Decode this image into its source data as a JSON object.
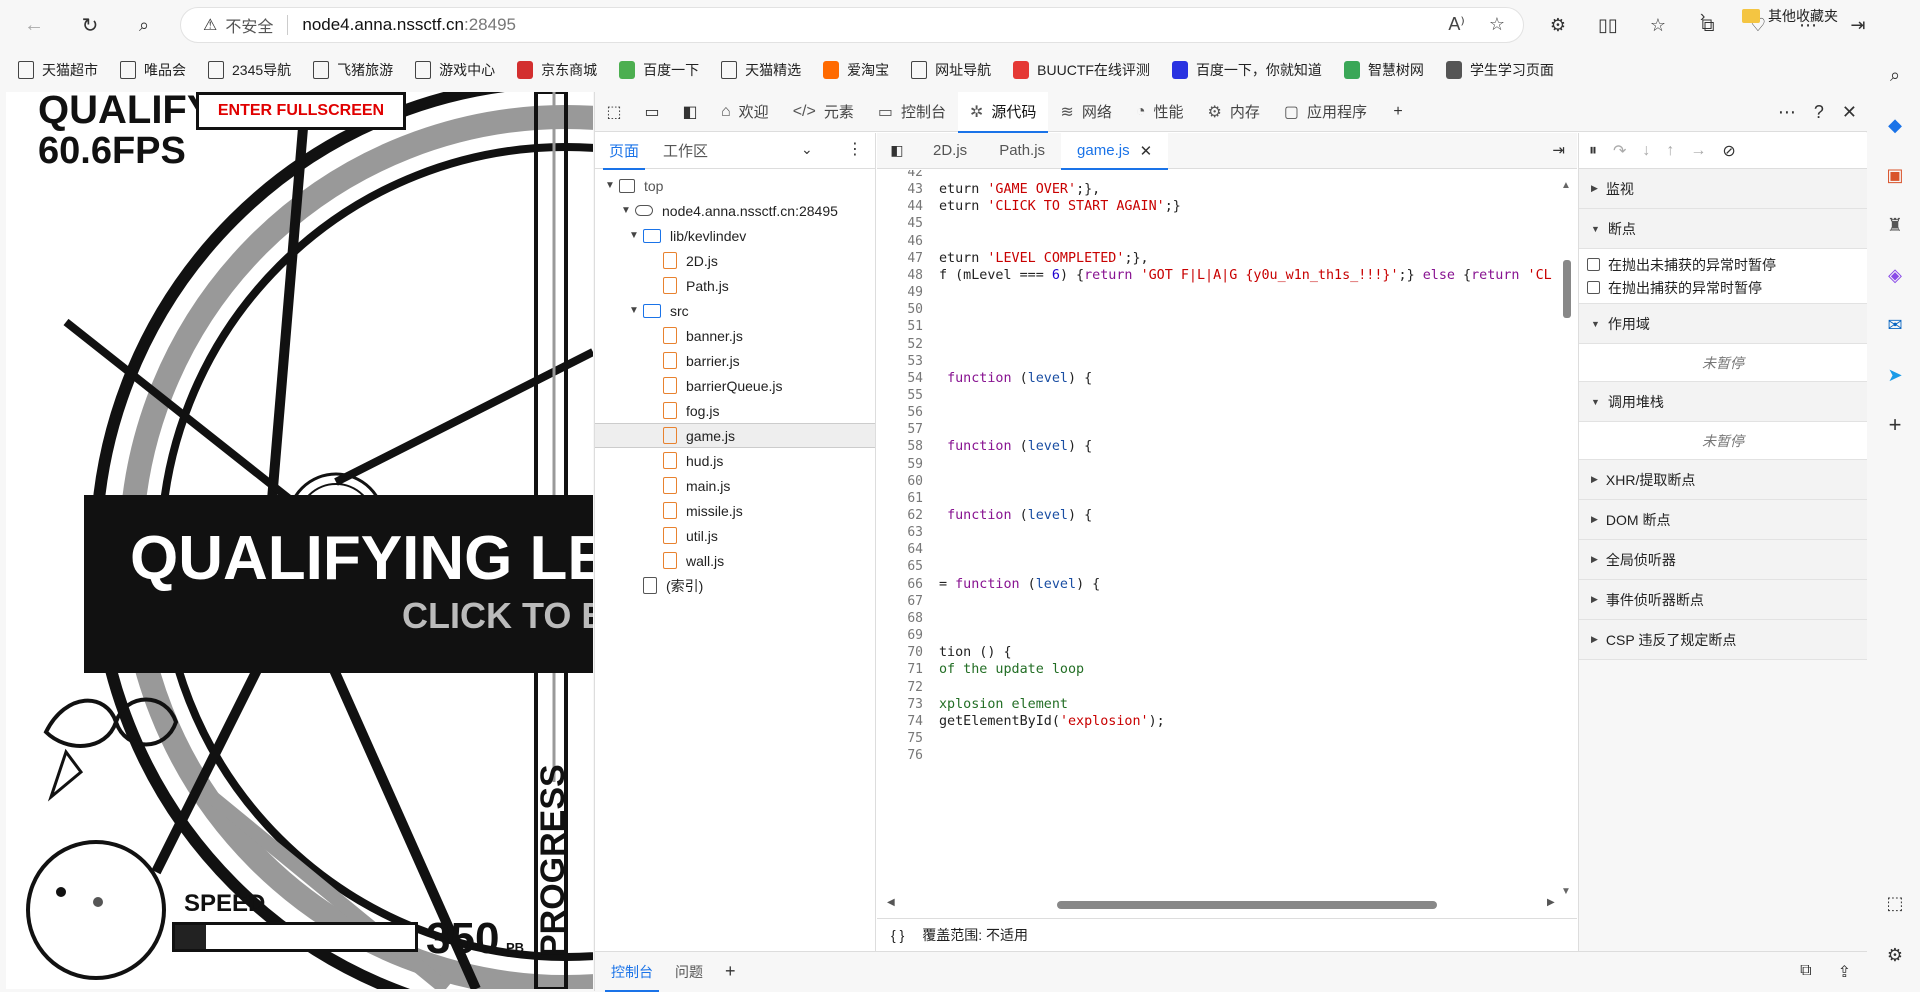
{
  "browser": {
    "security_label": "不安全",
    "url_host": "node4.anna.nssctf.cn",
    "url_port": ":28495"
  },
  "bookmarks": [
    {
      "label": "天猫超市",
      "color": ""
    },
    {
      "label": "唯品会",
      "color": ""
    },
    {
      "label": "2345导航",
      "color": ""
    },
    {
      "label": "飞猪旅游",
      "color": ""
    },
    {
      "label": "游戏中心",
      "color": ""
    },
    {
      "label": "京东商城",
      "color": "#d32f2f"
    },
    {
      "label": "百度一下",
      "color": "#4caf50"
    },
    {
      "label": "天猫精选",
      "color": ""
    },
    {
      "label": "爱淘宝",
      "color": "#ff6a00"
    },
    {
      "label": "网址导航",
      "color": ""
    },
    {
      "label": "BUUCTF在线评测",
      "color": "#e53935"
    },
    {
      "label": "百度一下，你就知道",
      "color": "#2932e1"
    },
    {
      "label": "智慧树网",
      "color": "#3aa757"
    },
    {
      "label": "学生学习页面",
      "color": "#555555"
    }
  ],
  "bookmarks_folder": "其他收藏夹",
  "game": {
    "qualify_top": "QUALIFY",
    "fps": "60.6FPS",
    "fullscreen_label": "ENTER FULLSCREEN",
    "banner_title": "QUALIFYING LEV",
    "banner_sub": "CLICK TO B",
    "speed_label": "SPEED",
    "speed_value": "350",
    "speed_unit": "PB",
    "speed_fraction": 0.13,
    "progress_label": "PROGRESS"
  },
  "devtools": {
    "tabs": [
      {
        "label": "欢迎",
        "icon": "home-icon"
      },
      {
        "label": "元素",
        "icon": "code-icon"
      },
      {
        "label": "控制台",
        "icon": "console-icon"
      },
      {
        "label": "源代码",
        "icon": "bug-icon",
        "active": true
      },
      {
        "label": "网络",
        "icon": "wifi-icon"
      },
      {
        "label": "性能",
        "icon": "gauge-icon"
      },
      {
        "label": "内存",
        "icon": "chip-icon"
      },
      {
        "label": "应用程序",
        "icon": "app-icon"
      }
    ],
    "navigator_tabs": [
      "页面",
      "工作区"
    ],
    "tree": [
      {
        "label": "top",
        "depth": 0,
        "kind": "page",
        "arrow": "▼"
      },
      {
        "label": "node4.anna.nssctf.cn:28495",
        "depth": 1,
        "kind": "cloud",
        "arrow": "▼"
      },
      {
        "label": "lib/kevlindev",
        "depth": 2,
        "kind": "dir",
        "arrow": "▼"
      },
      {
        "label": "2D.js",
        "depth": 3,
        "kind": "file",
        "arrow": ""
      },
      {
        "label": "Path.js",
        "depth": 3,
        "kind": "file",
        "arrow": ""
      },
      {
        "label": "src",
        "depth": 2,
        "kind": "dir",
        "arrow": "▼"
      },
      {
        "label": "banner.js",
        "depth": 3,
        "kind": "file",
        "arrow": ""
      },
      {
        "label": "barrier.js",
        "depth": 3,
        "kind": "file",
        "arrow": ""
      },
      {
        "label": "barrierQueue.js",
        "depth": 3,
        "kind": "file",
        "arrow": ""
      },
      {
        "label": "fog.js",
        "depth": 3,
        "kind": "file",
        "arrow": ""
      },
      {
        "label": "game.js",
        "depth": 3,
        "kind": "file",
        "arrow": "",
        "selected": true
      },
      {
        "label": "hud.js",
        "depth": 3,
        "kind": "file",
        "arrow": ""
      },
      {
        "label": "main.js",
        "depth": 3,
        "kind": "file",
        "arrow": ""
      },
      {
        "label": "missile.js",
        "depth": 3,
        "kind": "file",
        "arrow": ""
      },
      {
        "label": "util.js",
        "depth": 3,
        "kind": "file",
        "arrow": ""
      },
      {
        "label": "wall.js",
        "depth": 3,
        "kind": "file",
        "arrow": ""
      },
      {
        "label": "(索引)",
        "depth": 2,
        "kind": "gray",
        "arrow": ""
      }
    ],
    "editor_tabs": [
      {
        "label": "2D.js",
        "active": false
      },
      {
        "label": "Path.js",
        "active": false
      },
      {
        "label": "game.js",
        "active": true
      }
    ],
    "code_lines": [
      {
        "n": "42",
        "html": ""
      },
      {
        "n": "43",
        "html": "eturn <span class='tk-str'>'GAME OVER'</span>;},"
      },
      {
        "n": "44",
        "html": "eturn <span class='tk-str'>'CLICK TO START AGAIN'</span>;}"
      },
      {
        "n": "45",
        "html": ""
      },
      {
        "n": "46",
        "html": ""
      },
      {
        "n": "47",
        "html": "eturn <span class='tk-str'>'LEVEL COMPLETED'</span>;},"
      },
      {
        "n": "48",
        "html": "f (mLevel === <span class='tk-num'>6</span>) {<span class='tk-kw'>return</span> <span class='tk-str'>'GOT F|L|A|G {y0u_w1n_th1s_!!!}'</span>;} <span class='tk-kw'>else</span> {<span class='tk-kw'>return</span> <span class='tk-str'>'CL</span>"
      },
      {
        "n": "49",
        "html": ""
      },
      {
        "n": "50",
        "html": ""
      },
      {
        "n": "51",
        "html": ""
      },
      {
        "n": "52",
        "html": ""
      },
      {
        "n": "53",
        "html": ""
      },
      {
        "n": "54",
        "html": " <span class='tk-fn'>function</span> (<span class='tk-var'>level</span>) {"
      },
      {
        "n": "55",
        "html": ""
      },
      {
        "n": "56",
        "html": ""
      },
      {
        "n": "57",
        "html": ""
      },
      {
        "n": "58",
        "html": " <span class='tk-fn'>function</span> (<span class='tk-var'>level</span>) {"
      },
      {
        "n": "59",
        "html": ""
      },
      {
        "n": "60",
        "html": ""
      },
      {
        "n": "61",
        "html": ""
      },
      {
        "n": "62",
        "html": " <span class='tk-fn'>function</span> (<span class='tk-var'>level</span>) {"
      },
      {
        "n": "63",
        "html": ""
      },
      {
        "n": "64",
        "html": ""
      },
      {
        "n": "65",
        "html": ""
      },
      {
        "n": "66",
        "html": "= <span class='tk-fn'>function</span> (<span class='tk-var'>level</span>) {"
      },
      {
        "n": "67",
        "html": ""
      },
      {
        "n": "68",
        "html": ""
      },
      {
        "n": "69",
        "html": ""
      },
      {
        "n": "70",
        "html": "tion () {"
      },
      {
        "n": "71",
        "html": "<span class='tk-cm'>of the update loop</span>"
      },
      {
        "n": "72",
        "html": ""
      },
      {
        "n": "73",
        "html": "<span class='tk-cm'>xplosion element</span>"
      },
      {
        "n": "74",
        "html": "getElementById(<span class='tk-str'>'explosion'</span>);"
      },
      {
        "n": "75",
        "html": ""
      },
      {
        "n": "76",
        "html": ""
      }
    ],
    "footer_braces": "{ }",
    "footer_coverage": "覆盖范围: 不适用",
    "debug_sections": {
      "watch": "监视",
      "breakpoints": "断点",
      "pause_uncaught": "在抛出未捕获的异常时暂停",
      "pause_caught": "在抛出捕获的异常时暂停",
      "scope": "作用域",
      "not_paused_1": "未暂停",
      "call_stack": "调用堆栈",
      "not_paused_2": "未暂停",
      "xhr": "XHR/提取断点",
      "dom": "DOM 断点",
      "global": "全局侦听器",
      "event": "事件侦听器断点",
      "csp": "CSP 违反了规定断点"
    },
    "drawer_tabs": [
      "控制台",
      "问题"
    ]
  }
}
